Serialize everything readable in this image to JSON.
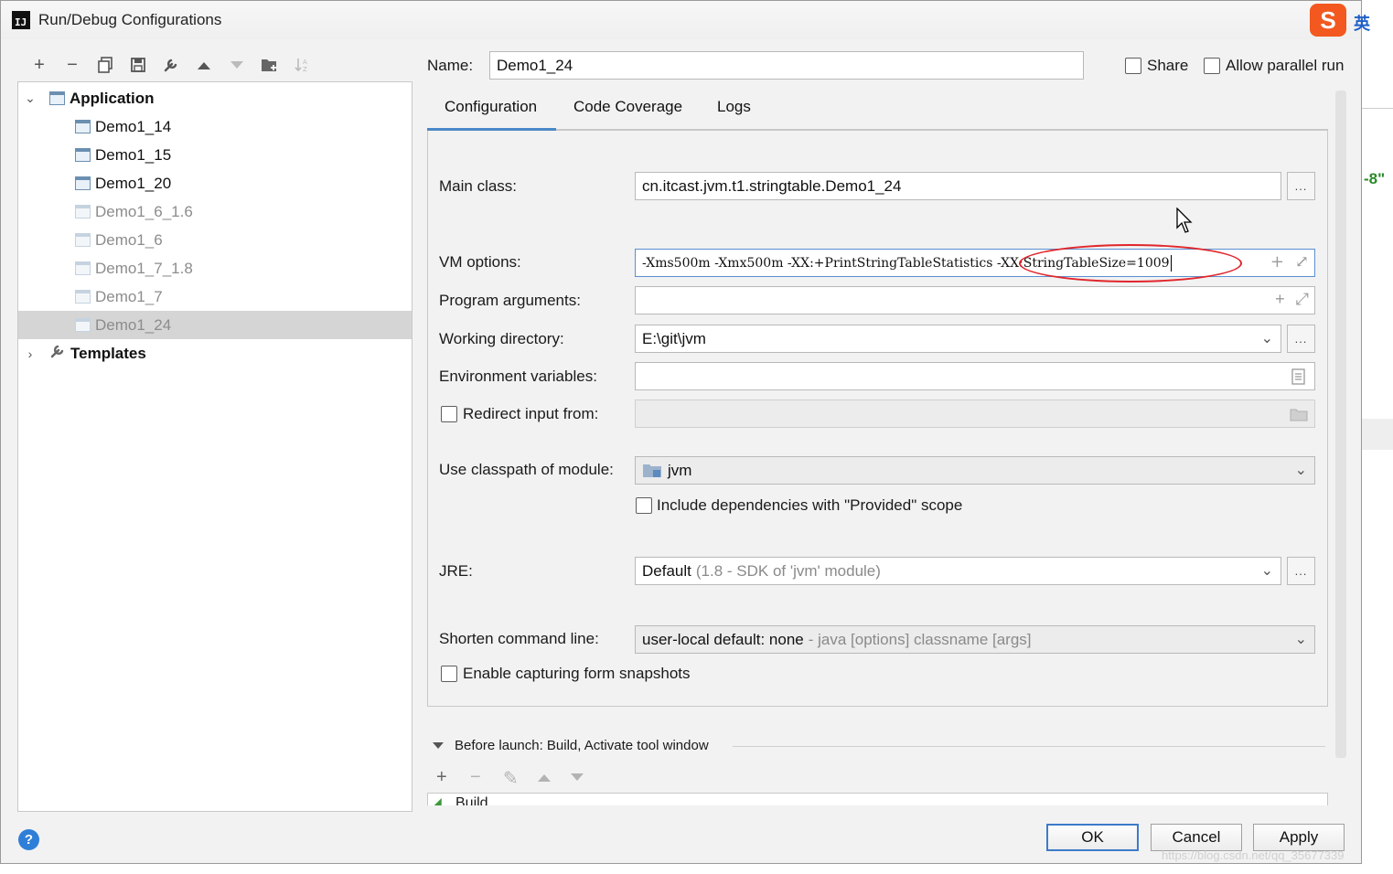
{
  "window": {
    "title": "Run/Debug Configurations"
  },
  "toolbar": {
    "icons": [
      "plus-icon",
      "minus-icon",
      "copy-icon",
      "save-icon",
      "wrench-icon",
      "arrow-up-icon",
      "arrow-down-icon",
      "folder-add-icon",
      "sort-icon"
    ]
  },
  "tree": {
    "application_label": "Application",
    "items": [
      {
        "label": "Demo1_14",
        "faded": false
      },
      {
        "label": "Demo1_15",
        "faded": false
      },
      {
        "label": "Demo1_20",
        "faded": false
      },
      {
        "label": "Demo1_6_1.6",
        "faded": true
      },
      {
        "label": "Demo1_6",
        "faded": true
      },
      {
        "label": "Demo1_7_1.8",
        "faded": true
      },
      {
        "label": "Demo1_7",
        "faded": true
      },
      {
        "label": "Demo1_24",
        "faded": true,
        "selected": true
      }
    ],
    "templates_label": "Templates"
  },
  "header": {
    "name_label": "Name:",
    "name_value": "Demo1_24",
    "share_label": "Share",
    "allow_parallel_label": "Allow parallel run"
  },
  "tabs": [
    {
      "label": "Configuration",
      "active": true
    },
    {
      "label": "Code Coverage",
      "active": false
    },
    {
      "label": "Logs",
      "active": false
    }
  ],
  "form": {
    "main_class_label": "Main class:",
    "main_class_value": "cn.itcast.jvm.t1.stringtable.Demo1_24",
    "vm_options_label": "VM options:",
    "vm_options_value": "-Xms500m -Xmx500m -XX:+PrintStringTableStatistics -XX:StringTableSize=1009",
    "program_args_label": "Program arguments:",
    "program_args_value": "",
    "working_dir_label": "Working directory:",
    "working_dir_value": "E:\\git\\jvm",
    "env_vars_label": "Environment variables:",
    "env_vars_value": "",
    "redirect_label": "Redirect input from:",
    "classpath_label": "Use classpath of module:",
    "classpath_value": "jvm",
    "include_deps_label": "Include dependencies with \"Provided\" scope",
    "jre_label": "JRE:",
    "jre_value": "Default",
    "jre_hint": "(1.8 - SDK of 'jvm' module)",
    "shorten_label": "Shorten command line:",
    "shorten_value": "user-local default: none",
    "shorten_hint": "- java [options] classname [args]",
    "capture_label": "Enable capturing form snapshots",
    "ellipsis": "..."
  },
  "before_launch": {
    "label": "Before launch: Build, Activate tool window",
    "build_item": "Build"
  },
  "buttons": {
    "ok": "OK",
    "cancel": "Cancel",
    "apply": "Apply"
  },
  "overlay": {
    "badge": "-8\"",
    "ime_char": "英",
    "watermark": "https://blog.csdn.net/qq_35677339",
    "sogou": "S"
  },
  "colors": {
    "accent": "#4a88c7",
    "highlight_ellipse": "#e0262b",
    "selected_row": "#d5d5d5"
  }
}
